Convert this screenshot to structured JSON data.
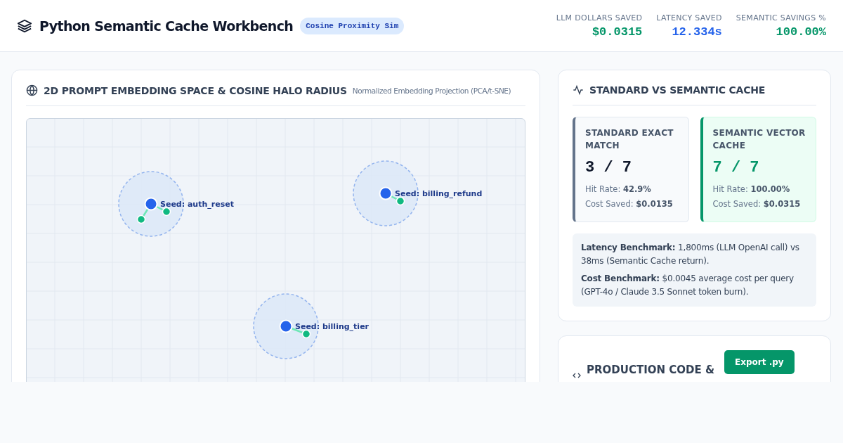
{
  "header": {
    "title": "Python Semantic Cache Workbench",
    "badge": "Cosine Proximity Sim",
    "stats": [
      {
        "label": "LLM DOLLARS SAVED",
        "value": "$0.0315",
        "color": "#059669"
      },
      {
        "label": "LATENCY SAVED",
        "value": "12.334s",
        "color": "#2563eb"
      },
      {
        "label": "SEMANTIC SAVINGS %",
        "value": "100.00%",
        "color": "#059669"
      }
    ]
  },
  "embedding_panel": {
    "title": "2D PROMPT EMBEDDING SPACE & COSINE HALO RADIUS",
    "subtitle": "Normalized Embedding Projection (PCA/t-SNE)",
    "seeds": [
      {
        "label": "Seed: auth_reset"
      },
      {
        "label": "Seed: billing_refund"
      },
      {
        "label": "Seed: billing_tier"
      }
    ]
  },
  "comparison_panel": {
    "title": "STANDARD VS SEMANTIC CACHE",
    "caches": [
      {
        "kind": "standard",
        "title": "STANDARD EXACT MATCH",
        "score": "3 / 7",
        "hit_rate_label": "Hit Rate:",
        "hit_rate": "42.9%",
        "cost_label": "Cost Saved:",
        "cost": "$0.0135"
      },
      {
        "kind": "semantic",
        "title": "SEMANTIC VECTOR CACHE",
        "score": "7 / 7",
        "hit_rate_label": "Hit Rate:",
        "hit_rate": "100.00%",
        "cost_label": "Cost Saved:",
        "cost": "$0.0315"
      }
    ],
    "benchmarks": [
      "**Latency Benchmark:** 1,800ms (LLM OpenAI call) vs 38ms (Semantic Cache return).",
      "**Cost Benchmark:** $0.0045 average cost per query (GPT-4o / Claude 3.5 Sonnet token burn)."
    ]
  },
  "code_panel": {
    "title": "PRODUCTION CODE &",
    "button": "Export .py"
  }
}
